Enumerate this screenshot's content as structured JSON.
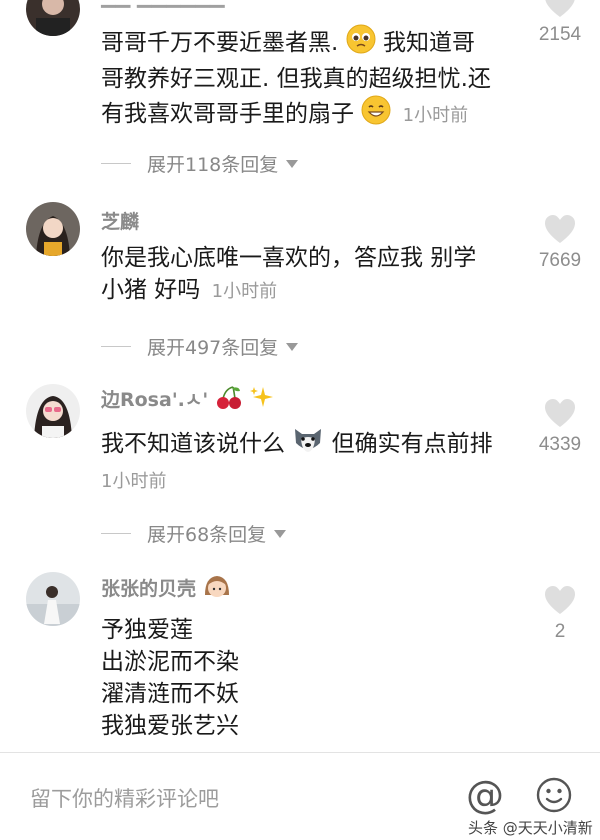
{
  "comments": [
    {
      "text_line1": "哥哥千万不要近墨者黑.",
      "text_line1b": "我知道哥",
      "text_line2": "哥教养好三观正. 但我真的超级担忧.还",
      "text_line3": "有我喜欢哥哥手里的扇子",
      "time": "1小时前",
      "likes": "2154",
      "expand": "展开118条回复"
    },
    {
      "username": "芝麟",
      "text_line1": "你是我心底唯一喜欢的，答应我 别学",
      "text_line2": "小猪 好吗",
      "time": "1小时前",
      "likes": "7669",
      "expand": "展开497条回复"
    },
    {
      "username": "边Rosa'.ㅅ'",
      "text_line1a": "我不知道该说什么",
      "text_line1b": "但确实有点前排",
      "time": "1小时前",
      "likes": "4339",
      "expand": "展开68条回复"
    },
    {
      "username": "张张的贝壳",
      "lines": [
        "予独爱莲",
        "出淤泥而不染",
        "濯清涟而不妖",
        "我独爱张艺兴"
      ],
      "likes": "2"
    }
  ],
  "footer": {
    "placeholder": "留下你的精彩评论吧",
    "at_symbol": "@",
    "watermark": "头条 @天天小清新"
  },
  "icons": {
    "like": "heart-icon",
    "mention": "at-icon",
    "emoji": "smiley-icon"
  },
  "colors": {
    "text": "#1a1a1a",
    "meta": "#9a9a9a",
    "heart": "#dedede"
  }
}
